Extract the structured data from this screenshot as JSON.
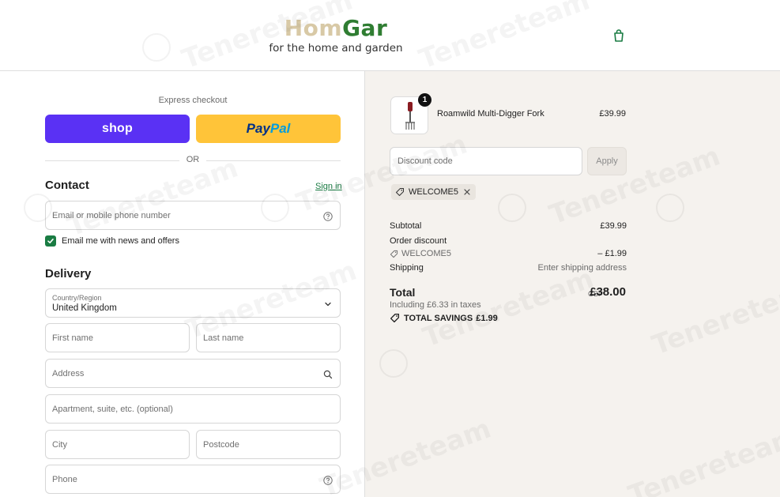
{
  "header": {
    "logo_part1": "Hom",
    "logo_part2": "Gar",
    "tagline": "for the home and garden",
    "cart_icon": "shopping-bag-icon"
  },
  "express": {
    "title": "Express checkout",
    "shop_label": "shop",
    "paypal_part1": "Pay",
    "paypal_part2": "Pal",
    "or_label": "OR"
  },
  "contact": {
    "heading": "Contact",
    "signin_label": "Sign in",
    "email_placeholder": "Email or mobile phone number",
    "newsletter_label": "Email me with news and offers",
    "newsletter_checked": true
  },
  "delivery": {
    "heading": "Delivery",
    "country_label": "Country/Region",
    "country_value": "United Kingdom",
    "first_name_placeholder": "First name",
    "last_name_placeholder": "Last name",
    "address_placeholder": "Address",
    "apartment_placeholder": "Apartment, suite, etc. (optional)",
    "city_placeholder": "City",
    "postcode_placeholder": "Postcode",
    "phone_placeholder": "Phone"
  },
  "order": {
    "product_name": "Roamwild Multi-Digger Fork",
    "product_price": "£39.99",
    "quantity": "1",
    "discount_placeholder": "Discount code",
    "apply_label": "Apply",
    "applied_code": "WELCOME5",
    "subtotal_label": "Subtotal",
    "subtotal_value": "£39.99",
    "order_discount_label": "Order discount",
    "discount_code_label": "WELCOME5",
    "discount_value": "– £1.99",
    "shipping_label": "Shipping",
    "shipping_value": "Enter shipping address",
    "total_label": "Total",
    "total_currency": "GBP",
    "total_value": "£38.00",
    "taxes_note": "Including £6.33 in taxes",
    "savings_label": "TOTAL SAVINGS",
    "savings_value": "£1.99"
  },
  "colors": {
    "shop_purple": "#5a31f4",
    "paypal_yellow": "#ffc439",
    "brand_green": "#1a7c43",
    "summary_bg": "#f5f2ee"
  },
  "watermark_text": "Tenereteam"
}
